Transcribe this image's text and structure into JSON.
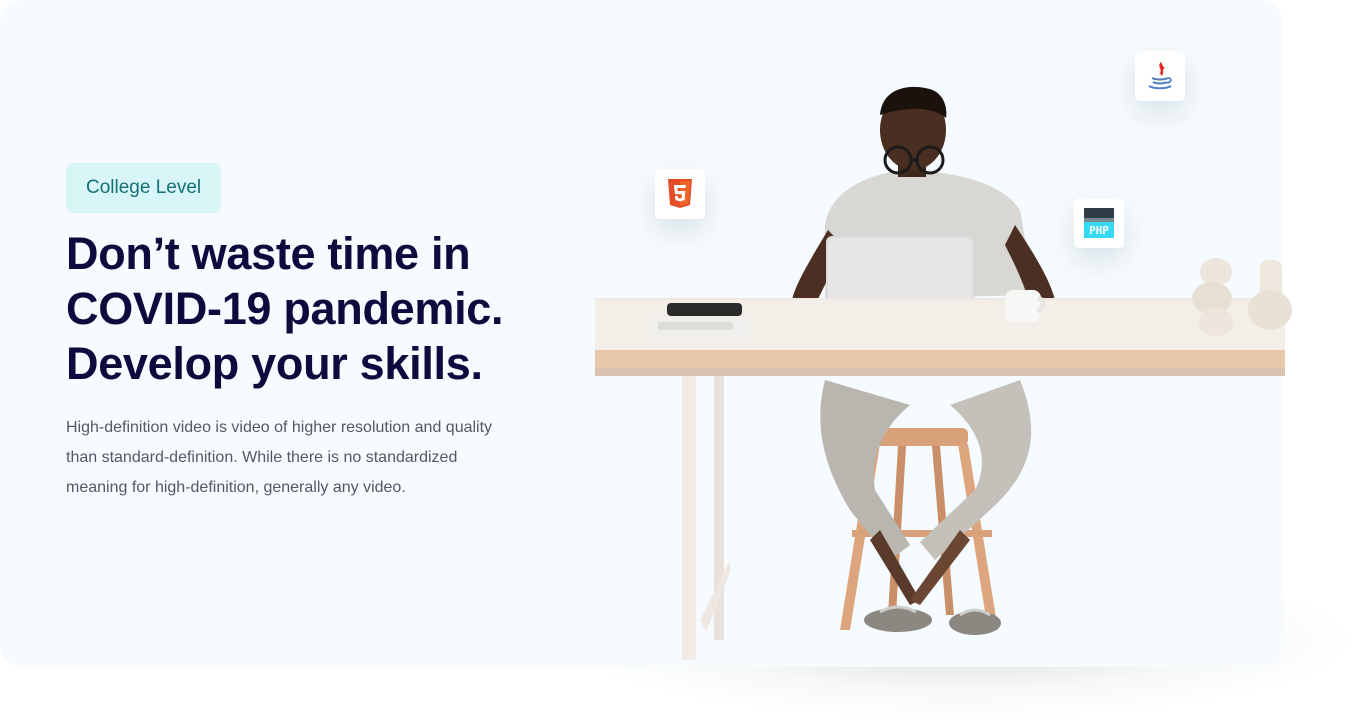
{
  "hero": {
    "badge": "College Level",
    "title_lines": [
      "Don’t waste time in",
      "COVID-19 pandemic.",
      "Develop your skills."
    ],
    "description_lines": [
      "High-definition video is video of higher resolution and quality",
      "than standard-definition. While there is no standardized",
      "meaning for high-definition, generally any video."
    ]
  },
  "icons": {
    "html": "html5-icon",
    "php": "php-icon",
    "java": "java-icon"
  },
  "colors": {
    "background": "#f5fbfe",
    "heading": "#0d0a3e",
    "badge_bg": "#d8f5f8",
    "badge_text": "#157077",
    "body_text": "#555766",
    "html_orange": "#e44d26",
    "php_cyan": "#35d9f2",
    "java_red": "#e1251b",
    "java_blue": "#4f7fc0"
  }
}
